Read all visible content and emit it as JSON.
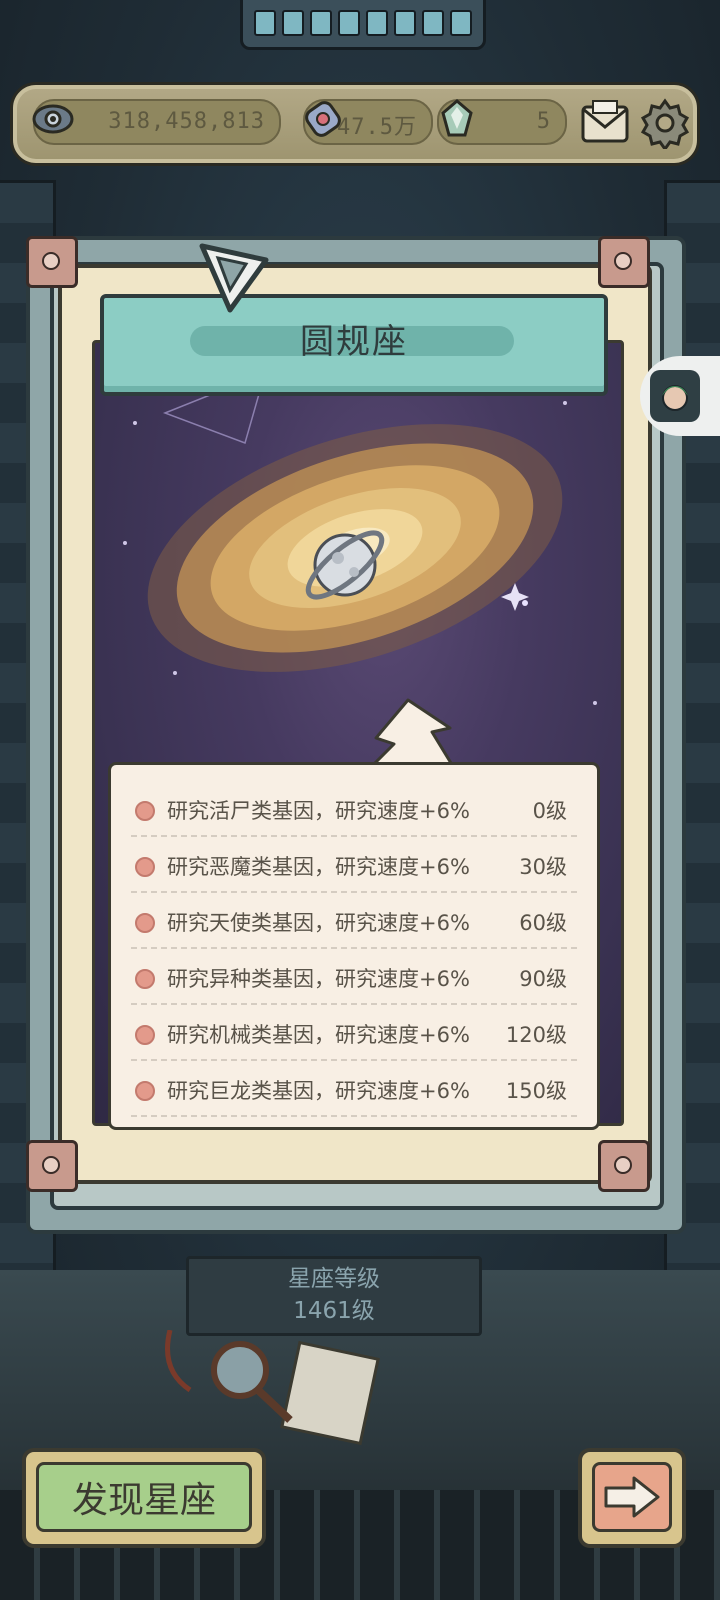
{
  "resources": {
    "eye_count": "318,458,813",
    "gem_count": "47.5万",
    "crystal_count": "5"
  },
  "constellation": {
    "name": "圆规座",
    "bonuses": [
      {
        "text": "研究活尸类基因，研究速度+6%",
        "level": "0级"
      },
      {
        "text": "研究恶魔类基因，研究速度+6%",
        "level": "30级"
      },
      {
        "text": "研究天使类基因，研究速度+6%",
        "level": "60级"
      },
      {
        "text": "研究异种类基因，研究速度+6%",
        "level": "90级"
      },
      {
        "text": "研究机械类基因，研究速度+6%",
        "level": "120级"
      },
      {
        "text": "研究巨龙类基因，研究速度+6%",
        "level": "150级"
      }
    ],
    "level_label": "星座等级",
    "level_value": "1461级"
  },
  "buttons": {
    "discover": "发现星座"
  },
  "icons": {
    "eye": "eye-icon",
    "gem": "gem-icon",
    "crystal": "crystal-icon",
    "mail": "mail-icon",
    "settings": "gear-icon",
    "next": "arrow-right-icon",
    "compass": "compass-clip-icon",
    "avatar": "avatar-icon"
  },
  "colors": {
    "title_banner": "#8ccdc4",
    "bonus_dot": "#e39a8b",
    "discover_button": "#a7cf8b",
    "next_button": "#e7a58b"
  }
}
